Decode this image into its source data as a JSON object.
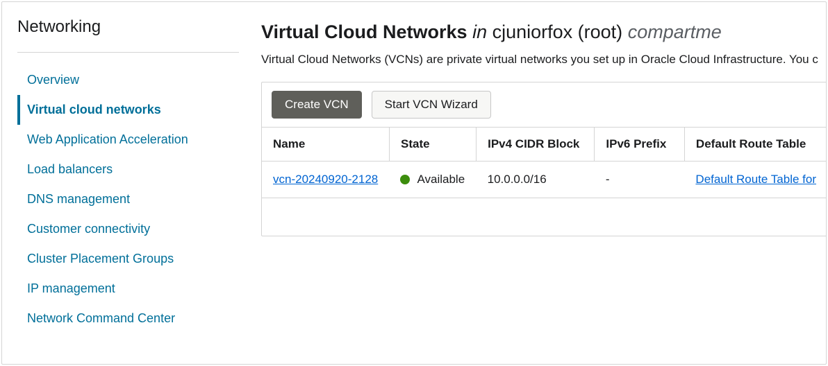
{
  "sidebar": {
    "title": "Networking",
    "items": [
      {
        "label": "Overview",
        "active": false
      },
      {
        "label": "Virtual cloud networks",
        "active": true
      },
      {
        "label": "Web Application Acceleration",
        "active": false
      },
      {
        "label": "Load balancers",
        "active": false
      },
      {
        "label": "DNS management",
        "active": false
      },
      {
        "label": "Customer connectivity",
        "active": false
      },
      {
        "label": "Cluster Placement Groups",
        "active": false
      },
      {
        "label": "IP management",
        "active": false
      },
      {
        "label": "Network Command Center",
        "active": false
      }
    ]
  },
  "heading": {
    "main": "Virtual Cloud Networks",
    "in": "in",
    "compartment_name": "cjuniorfox (root)",
    "suffix": "compartme"
  },
  "description": "Virtual Cloud Networks (VCNs) are private virtual networks you set up in Oracle Cloud Infrastructure. You c",
  "toolbar": {
    "create_label": "Create VCN",
    "wizard_label": "Start VCN Wizard"
  },
  "table": {
    "headers": {
      "name": "Name",
      "state": "State",
      "cidr": "IPv4 CIDR Block",
      "ipv6": "IPv6 Prefix",
      "route": "Default Route Table"
    },
    "rows": [
      {
        "name": "vcn-20240920-2128",
        "state": "Available",
        "cidr": "10.0.0.0/16",
        "ipv6": "-",
        "route": "Default Route Table for"
      }
    ]
  }
}
